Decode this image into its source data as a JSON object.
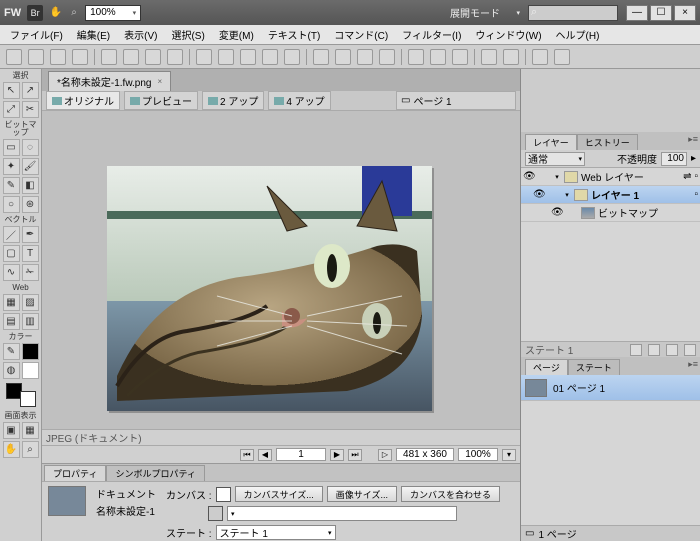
{
  "title": {
    "app": "FW",
    "br": "Br",
    "zoom": "100%",
    "display_mode": "展開モード",
    "search": ""
  },
  "window_buttons": {
    "min": "—",
    "max": "☐",
    "close": "×"
  },
  "menu": [
    "ファイル(F)",
    "編集(E)",
    "表示(V)",
    "選択(S)",
    "変更(M)",
    "テキスト(T)",
    "コマンド(C)",
    "フィルター(I)",
    "ウィンドウ(W)",
    "ヘルプ(H)"
  ],
  "tab": {
    "filename": "*名称未設定-1.fw.png"
  },
  "viewbar": {
    "original": "オリジナル",
    "preview": "プレビュー",
    "two_up": "2 アップ",
    "four_up": "4 アップ",
    "page": "ページ 1"
  },
  "status": {
    "jpeg": "JPEG (ドキュメント)"
  },
  "nav": {
    "frame": "1",
    "dims": "481 x 360",
    "zoom": "100%"
  },
  "tools": {
    "select": "選択",
    "bitmap": "ビットマップ",
    "vector": "ベクトル",
    "web": "Web",
    "color": "カラー",
    "view": "画面表示"
  },
  "prop": {
    "tab1": "プロパティ",
    "tab2": "シンボルプロパティ",
    "doc": "ドキュメント",
    "docname": "名称未設定-1",
    "canvas": "カンバス :",
    "canvas_size": "カンバスサイズ...",
    "image_size": "画像サイズ...",
    "fit_canvas": "カンバスを合わせる",
    "state": "ステート :",
    "state_val": "ステート 1"
  },
  "right": {
    "layers": {
      "tab1": "レイヤー",
      "tab2": "ヒストリー",
      "blend": "通常",
      "opacity_lbl": "不透明度",
      "opacity": "100",
      "items": [
        {
          "name": "Web レイヤー",
          "type": "folder"
        },
        {
          "name": "レイヤー 1",
          "type": "folder",
          "selected": true,
          "bold": true
        },
        {
          "name": "ビットマップ",
          "type": "bitmap",
          "indent": 2
        }
      ],
      "foot": "ステート 1"
    },
    "pages": {
      "tab1": "ページ",
      "tab2": "ステート",
      "item": "01 ページ 1",
      "footer": "1 ページ"
    }
  }
}
